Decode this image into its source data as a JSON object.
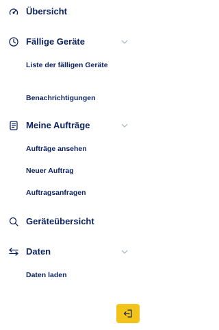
{
  "nav": {
    "overview": {
      "label": "Übersicht",
      "icon": "dashboard-gauge-icon"
    },
    "due_devices": {
      "label": "Fällige Geräte",
      "icon": "clock-icon",
      "children": [
        "Liste der fälligen Geräte",
        "Benachrichtigungen"
      ]
    },
    "orders": {
      "label": "Meine Aufträge",
      "icon": "document-list-icon",
      "children": [
        "Aufträge ansehen",
        "Neuer Auftrag",
        "Auftragsanfragen"
      ]
    },
    "devices": {
      "label": "Geräteübersicht",
      "icon": "search-icon"
    },
    "data": {
      "label": "Daten",
      "icon": "transfer-arrows-icon",
      "children": [
        "Daten laden"
      ]
    }
  },
  "logout": {
    "icon": "logout-icon",
    "color": "#f2c319"
  },
  "colors": {
    "text": "#0e2460",
    "chevron": "#a7b0c6",
    "accent": "#f2c319"
  }
}
